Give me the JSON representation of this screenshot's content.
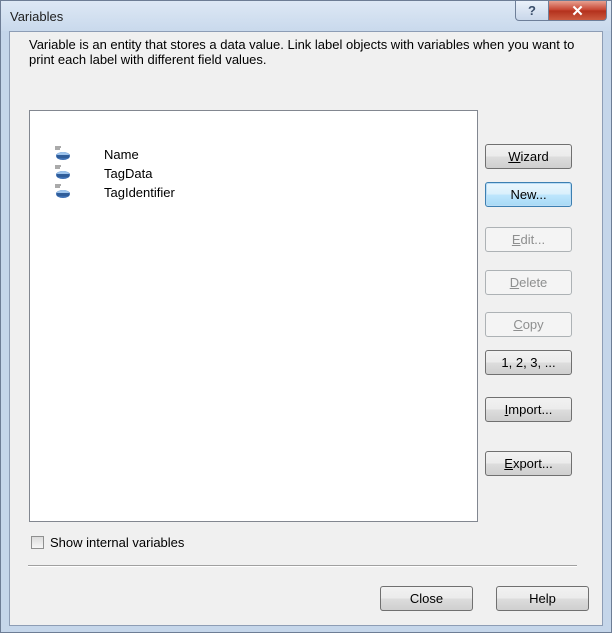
{
  "window": {
    "title": "Variables",
    "help_button": "?",
    "close_button": "✕"
  },
  "description": "Variable is an entity that stores a data value. Link label objects with variables when you want to print each label with different field values.",
  "variables": [
    {
      "label": "Name",
      "icon": "variable-icon"
    },
    {
      "label": "TagData",
      "icon": "variable-icon"
    },
    {
      "label": "TagIdentifier",
      "icon": "variable-icon"
    }
  ],
  "buttons": {
    "wizard": {
      "pre": "",
      "mn": "W",
      "post": "izard",
      "enabled": true
    },
    "new": {
      "pre": "",
      "mn": "",
      "post": "New...",
      "enabled": true,
      "default": true
    },
    "edit": {
      "pre": "",
      "mn": "E",
      "post": "dit...",
      "enabled": false
    },
    "delete": {
      "pre": "",
      "mn": "D",
      "post": "elete",
      "enabled": false
    },
    "copy": {
      "pre": "",
      "mn": "C",
      "post": "opy",
      "enabled": false
    },
    "sequence": {
      "pre": "",
      "mn": "",
      "post": "1, 2, 3, ...",
      "enabled": true
    },
    "import": {
      "pre": "",
      "mn": "I",
      "post": "mport...",
      "enabled": true
    },
    "export": {
      "pre": "",
      "mn": "E",
      "post": "xport...",
      "enabled": true
    }
  },
  "show_internal": {
    "label": "Show internal variables",
    "checked": false
  },
  "footer": {
    "close": "Close",
    "help": "Help"
  }
}
